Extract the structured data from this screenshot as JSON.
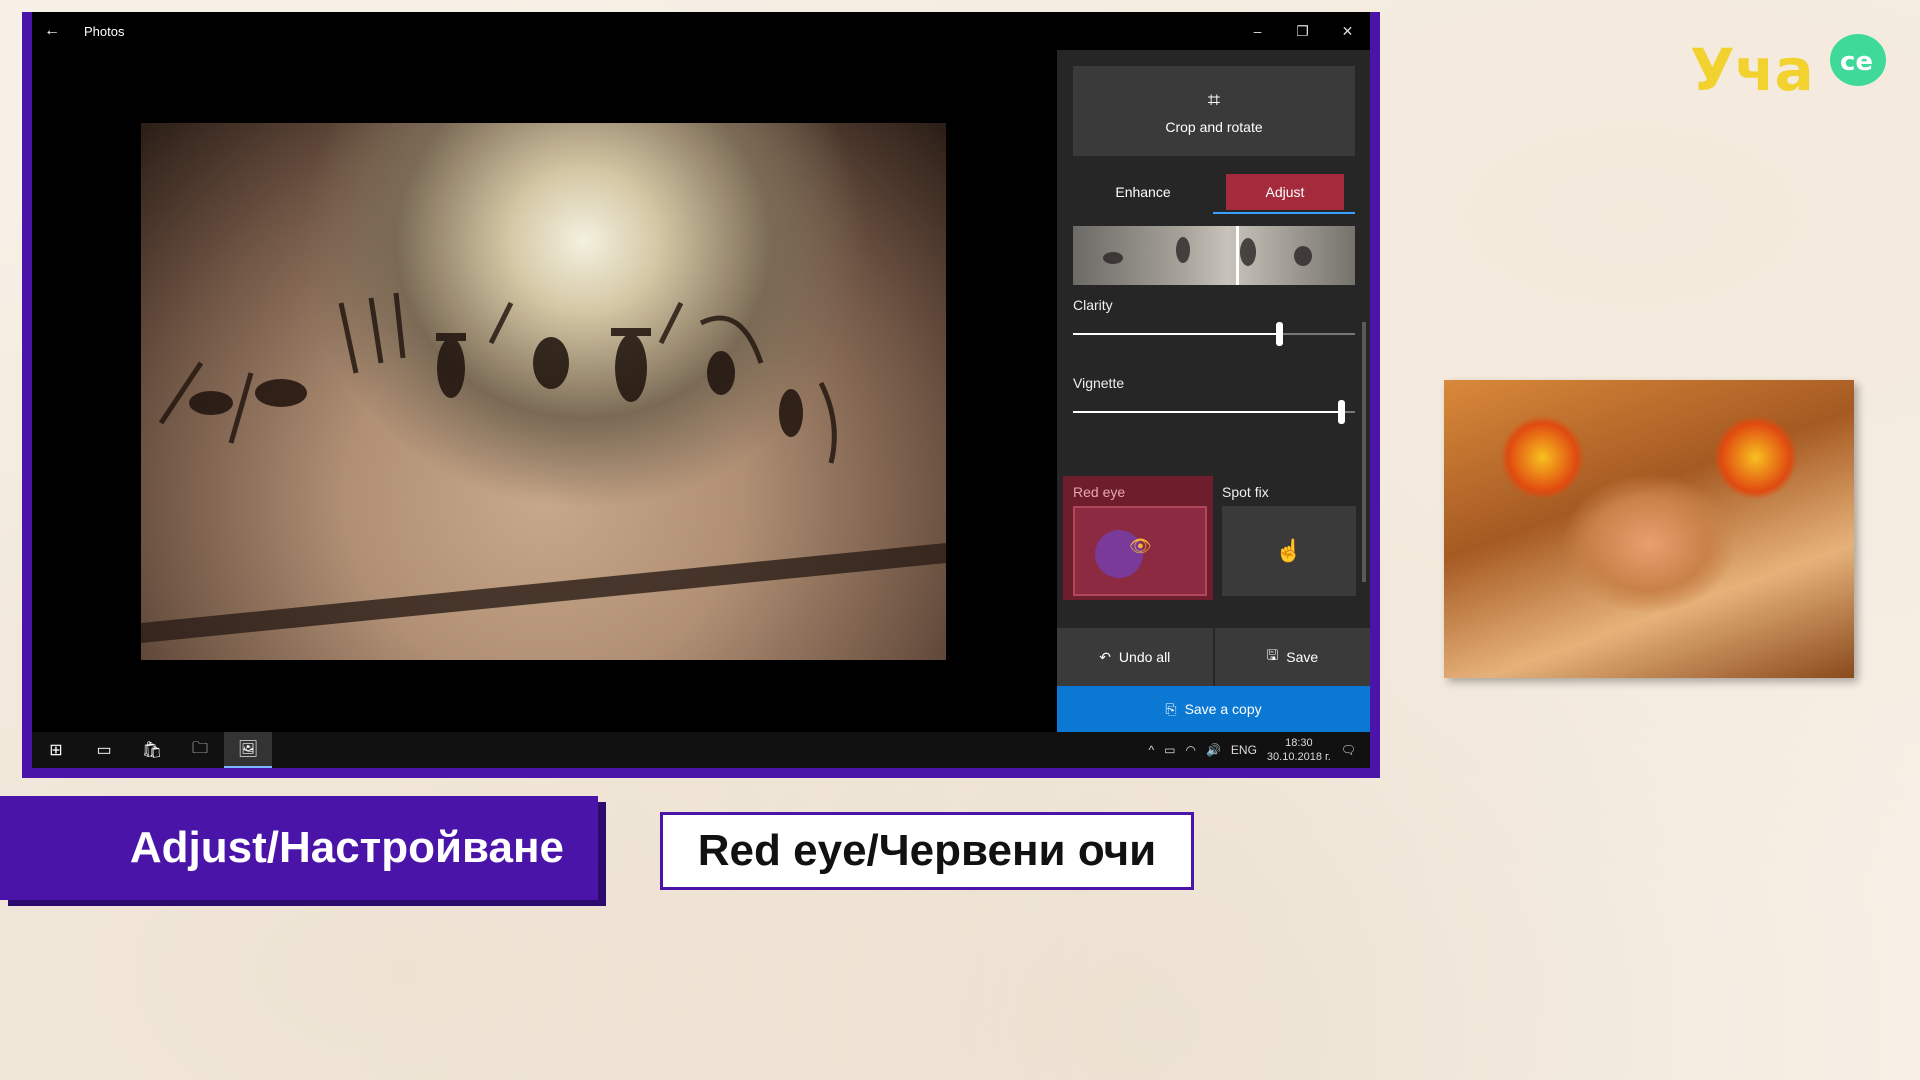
{
  "window": {
    "title": "Photos",
    "back_icon": "←",
    "minimize_icon": "–",
    "restore_icon": "❐",
    "close_icon": "✕"
  },
  "panel": {
    "crop_label": "Crop and rotate",
    "crop_icon": "⌗",
    "tabs": [
      {
        "label": "Enhance",
        "active": false
      },
      {
        "label": "Adjust",
        "active": true
      }
    ],
    "clarity_label": "Clarity",
    "clarity_value": 0.73,
    "vignette_label": "Vignette",
    "vignette_value": 0.95,
    "red_eye_label": "Red eye",
    "red_eye_icon": "👁",
    "spot_fix_label": "Spot fix",
    "spot_fix_icon": "☝",
    "undo_label": "Undo all",
    "undo_icon": "↶",
    "save_label": "Save",
    "save_icon": "🖫",
    "save_copy_label": "Save a copy",
    "save_copy_icon": "⎘"
  },
  "taskbar": {
    "start_icon": "⊞",
    "taskview_icon": "▭",
    "store_icon": "🛍",
    "explorer_icon": "🗀",
    "photos_icon": "🖼",
    "tray_chevron": "^",
    "battery_icon": "▭",
    "wifi_icon": "◠",
    "volume_icon": "🔊",
    "lang": "ENG",
    "time": "18:30",
    "date": "30.10.2018 г.",
    "notif_icon": "🗨"
  },
  "captions": {
    "left": "Adjust/Настройване",
    "right": "Red eye/Червени очи"
  },
  "logo": {
    "text_main": "Уча",
    "text_bubble": "се",
    "color_yellow": "#f2d22e",
    "color_green": "#3fd99a"
  },
  "colors": {
    "accent_purple": "#4b14a8",
    "adjust_tab": "#a42a3c",
    "save_copy": "#0b78d4"
  }
}
